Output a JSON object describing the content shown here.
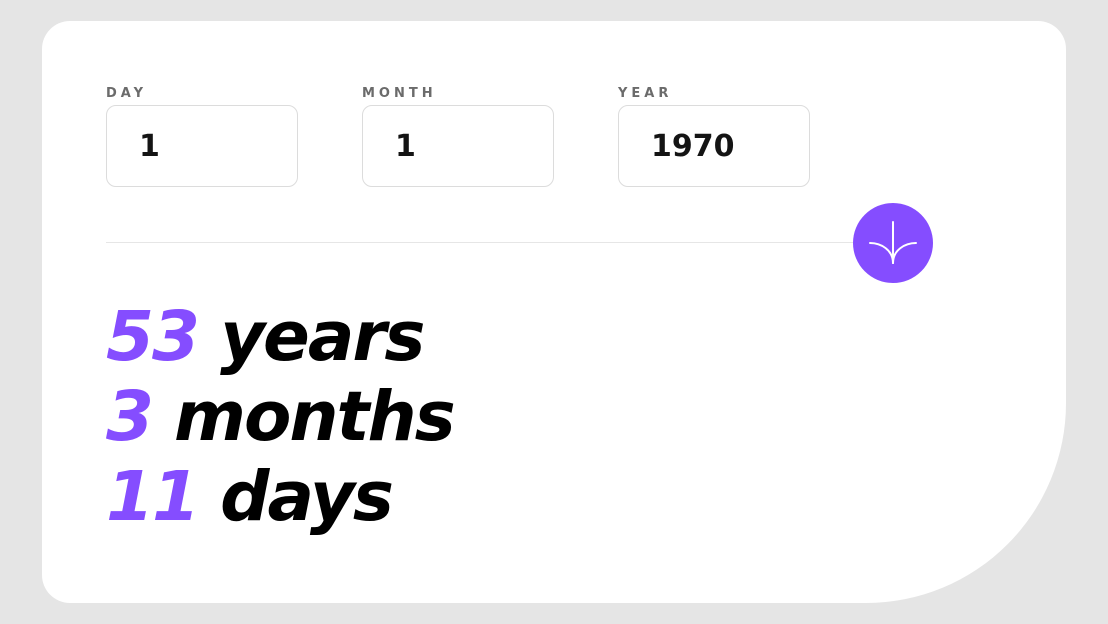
{
  "colors": {
    "background": "#e5e5e5",
    "card": "#ffffff",
    "accent": "#854dff",
    "label": "#6b6b6b",
    "text": "#000000"
  },
  "form": {
    "day": {
      "label": "DAY",
      "value": "1"
    },
    "month": {
      "label": "MONTH",
      "value": "1"
    },
    "year": {
      "label": "YEAR",
      "value": "1970"
    },
    "submit_icon": "arrow-down-icon"
  },
  "results": {
    "years": {
      "value": "53",
      "unit": "years"
    },
    "months": {
      "value": "3",
      "unit": "months"
    },
    "days": {
      "value": "11",
      "unit": "days"
    }
  }
}
